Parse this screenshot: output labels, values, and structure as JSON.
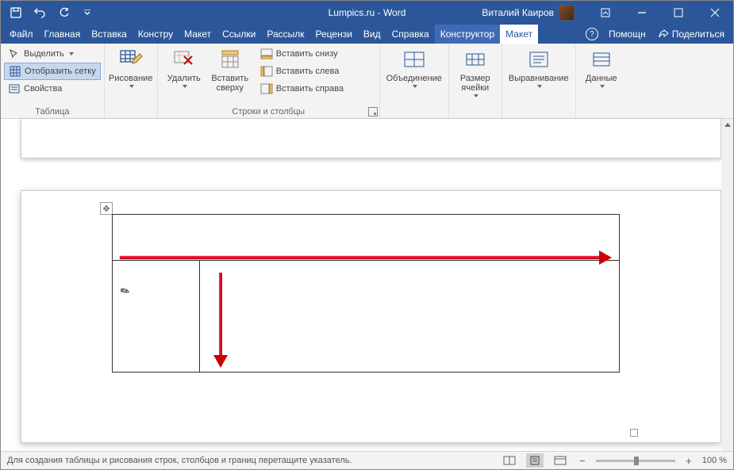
{
  "titlebar": {
    "title": "Lumpics.ru - Word",
    "user": "Виталий Каиров"
  },
  "tabs": {
    "file": "Файл",
    "home": "Главная",
    "insert": "Вставка",
    "design": "Констру",
    "layout": "Макет",
    "references": "Ссылки",
    "mailings": "Рассылк",
    "review": "Рецензи",
    "view": "Вид",
    "help": "Справка",
    "ctx_design": "Конструктор",
    "ctx_layout": "Макет",
    "assist": "Помощн",
    "share": "Поделиться"
  },
  "ribbon": {
    "table_group": {
      "select": "Выделить",
      "gridlines": "Отобразить сетку",
      "properties": "Свойства",
      "label": "Таблица"
    },
    "draw_group": {
      "draw": "Рисование"
    },
    "delete": "Удалить",
    "insert_above": "Вставить сверху",
    "insert_below": "Вставить снизу",
    "insert_left": "Вставить слева",
    "insert_right": "Вставить справа",
    "rows_cols_label": "Строки и столбцы",
    "merge": "Объединение",
    "cell_size": "Размер ячейки",
    "alignment": "Выравнивание",
    "data": "Данные"
  },
  "statusbar": {
    "hint": "Для создания таблицы и рисования строк, столбцов и границ перетащите указатель.",
    "zoom": "100 %"
  }
}
